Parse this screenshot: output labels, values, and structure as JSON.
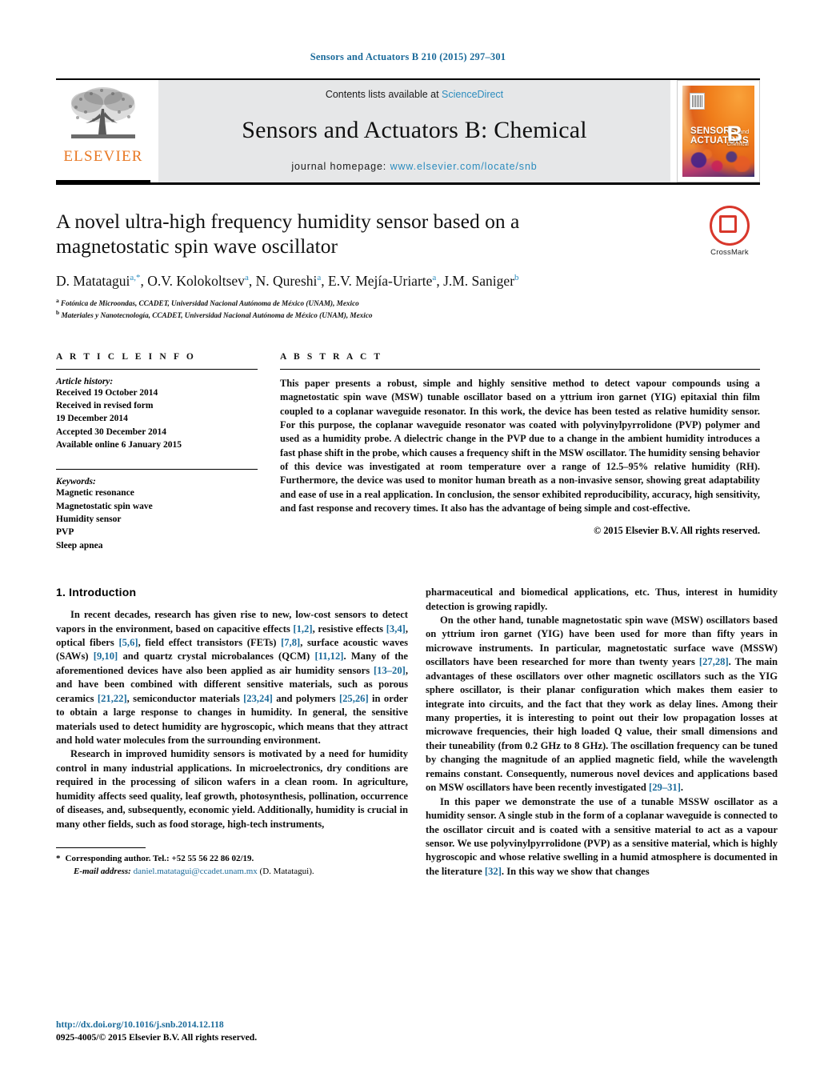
{
  "running_head": "Sensors and Actuators B 210 (2015) 297–301",
  "masthead": {
    "elsevier_wordmark": "ELSEVIER",
    "contents_prefix": "Contents lists available at ",
    "contents_link": "ScienceDirect",
    "journal_title": "Sensors and Actuators B: Chemical",
    "homepage_prefix": "journal homepage: ",
    "homepage_url": "www.elsevier.com/locate/snb",
    "cover": {
      "line1": "SENSORS",
      "and": "and",
      "line2": "ACTUATORS",
      "series": "B",
      "series_sub": "Chemical"
    }
  },
  "article": {
    "title": "A novel ultra-high frequency humidity sensor based on a magnetostatic spin wave oscillator",
    "authors_html": "D. Matatagui<sup>a,*</sup>, O.V. Kolokoltsev<sup>a</sup>, N. Qureshi<sup>a</sup>, E.V. Mejía-Uriarte<sup>a</sup>, J.M. Saniger<sup>b</sup>",
    "affiliations": [
      "Fotónica de Microondas, CCADET, Universidad Nacional Autónoma de México (UNAM), Mexico",
      "Materiales y Nanotecnología, CCADET, Universidad Nacional Autónoma de México (UNAM), Mexico"
    ],
    "crossmark_label": "CrossMark"
  },
  "article_info": {
    "heading": "A R T I C L E   I N F O",
    "history_label": "Article history:",
    "history": [
      "Received 19 October 2014",
      "Received in revised form",
      "19 December 2014",
      "Accepted 30 December 2014",
      "Available online 6 January 2015"
    ],
    "keywords_label": "Keywords:",
    "keywords": [
      "Magnetic resonance",
      "Magnetostatic spin wave",
      "Humidity sensor",
      "PVP",
      "Sleep apnea"
    ]
  },
  "abstract": {
    "heading": "A B S T R A C T",
    "text": "This paper presents a robust, simple and highly sensitive method to detect vapour compounds using a magnetostatic spin wave (MSW) tunable oscillator based on a yttrium iron garnet (YIG) epitaxial thin film coupled to a coplanar waveguide resonator. In this work, the device has been tested as relative humidity sensor. For this purpose, the coplanar waveguide resonator was coated with polyvinylpyrrolidone (PVP) polymer and used as a humidity probe. A dielectric change in the PVP due to a change in the ambient humidity introduces a fast phase shift in the probe, which causes a frequency shift in the MSW oscillator. The humidity sensing behavior of this device was investigated at room temperature over a range of 12.5–95% relative humidity (RH). Furthermore, the device was used to monitor human breath as a non-invasive sensor, showing great adaptability and ease of use in a real application. In conclusion, the sensor exhibited reproducibility, accuracy, high sensitivity, and fast response and recovery times. It also has the advantage of being simple and cost-effective.",
    "copyright": "© 2015 Elsevier B.V. All rights reserved."
  },
  "body": {
    "section_number_title": "1.  Introduction",
    "left_paragraphs": [
      "In recent decades, research has given rise to new, low-cost sensors to detect vapors in the environment, based on capacitive effects [1,2], resistive effects [3,4], optical fibers [5,6], field effect transistors (FETs) [7,8], surface acoustic waves (SAWs) [9,10] and quartz crystal microbalances (QCM) [11,12]. Many of the aforementioned devices have also been applied as air humidity sensors [13–20], and have been combined with different sensitive materials, such as porous ceramics [21,22], semiconductor materials [23,24] and polymers [25,26] in order to obtain a large response to changes in humidity. In general, the sensitive materials used to detect humidity are hygroscopic, which means that they attract and hold water molecules from the surrounding environment.",
      "Research in improved humidity sensors is motivated by a need for humidity control in many industrial applications. In microelectronics, dry conditions are required in the processing of silicon wafers in a clean room. In agriculture, humidity affects seed quality, leaf growth, photosynthesis, pollination, occurrence of diseases, and, subsequently, economic yield. Additionally, humidity is crucial in many other fields, such as food storage, high-tech instruments,"
    ],
    "right_paragraphs": [
      "pharmaceutical and biomedical applications, etc. Thus, interest in humidity detection is growing rapidly.",
      "On the other hand, tunable magnetostatic spin wave (MSW) oscillators based on yttrium iron garnet (YIG) have been used for more than fifty years in microwave instruments. In particular, magnetostatic surface wave (MSSW) oscillators have been researched for more than twenty years [27,28]. The main advantages of these oscillators over other magnetic oscillators such as the YIG sphere oscillator, is their planar configuration which makes them easier to integrate into circuits, and the fact that they work as delay lines. Among their many properties, it is interesting to point out their low propagation losses at microwave frequencies, their high loaded Q value, their small dimensions and their tuneability (from 0.2 GHz to 8 GHz). The oscillation frequency can be tuned by changing the magnitude of an applied magnetic field, while the wavelength remains constant. Consequently, numerous novel devices and applications based on MSW oscillators have been recently investigated [29–31].",
      "In this paper we demonstrate the use of a tunable MSSW oscillator as a humidity sensor. A single stub in the form of a coplanar waveguide is connected to the oscillator circuit and is coated with a sensitive material to act as a vapour sensor. We use polyvinylpyrrolidone (PVP) as a sensitive material, which is highly hygroscopic and whose relative swelling in a humid atmosphere is documented in the literature [32]. In this way we show that changes"
    ]
  },
  "footnote": {
    "star": "*",
    "corresponding": "Corresponding author. Tel.: +52 55 56 22 86 02/19.",
    "email_label": "E-mail address:",
    "email": "daniel.matatagui@ccadet.unam.mx",
    "email_suffix": "(D. Matatagui)."
  },
  "footer": {
    "doi": "http://dx.doi.org/10.1016/j.snb.2014.12.118",
    "issn": "0925-4005/© 2015 Elsevier B.V. All rights reserved."
  },
  "colors": {
    "link_blue": "#2b8cbe",
    "ref_blue": "#1a6a9a",
    "elsevier_orange": "#E87722",
    "crossmark_red": "#d8372b",
    "band_gray": "#e6e7e8"
  }
}
